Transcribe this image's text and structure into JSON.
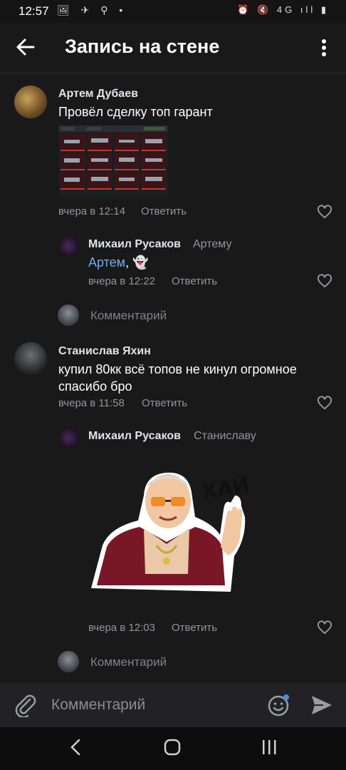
{
  "status_bar": {
    "time": "12:57",
    "left_icons": "🖼 ✈ ⚲ •",
    "right_icons": "⏰ 🔇 4G ıll ▮"
  },
  "header": {
    "title": "Запись на стене"
  },
  "comments": [
    {
      "author": "Артем Дубаев",
      "text": "Провёл сделку топ гарант",
      "time": "вчера в 12:14",
      "reply_label": "Ответить",
      "replies": [
        {
          "author": "Михаил Русаков",
          "reply_to": "Артему",
          "mention": "Артем",
          "text_after_mention": ", 👻",
          "time": "вчера в 12:22",
          "reply_label": "Ответить"
        }
      ],
      "comment_placeholder": "Комментарий"
    },
    {
      "author": "Станислав Яхин",
      "text_line1": "купил 80кк всё топов не кинул огромное",
      "text_line2": "спасибо бро",
      "time": "вчера в 11:58",
      "reply_label": "Ответить",
      "replies": [
        {
          "author": "Михаил Русаков",
          "reply_to": "Станиславу",
          "sticker_text": "ХАЙ",
          "time": "вчера в 12:03",
          "reply_label": "Ответить"
        }
      ],
      "comment_placeholder": "Комментарий"
    }
  ],
  "input": {
    "placeholder": "Комментарий"
  },
  "colors": {
    "background": "#19191a",
    "accent": "#71aaeb",
    "secondary_text": "#939599"
  }
}
